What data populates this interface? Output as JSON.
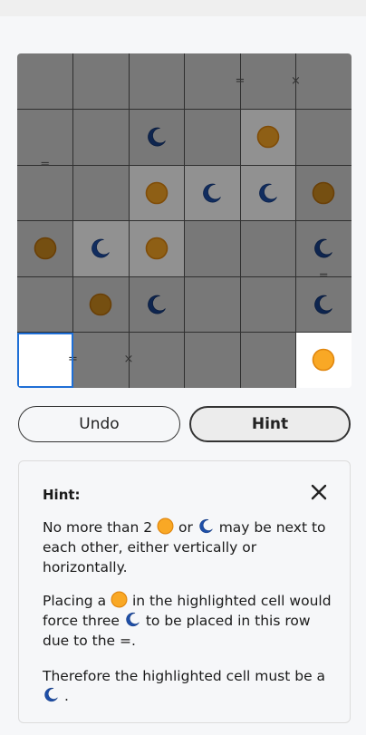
{
  "colors": {
    "sun": "#f9a825",
    "sun_border": "#e0860e",
    "moon": "#1e4fa8",
    "overlay": "#000000",
    "selection": "#1f6fd6"
  },
  "board": {
    "size": 6,
    "cells": [
      [
        "",
        "",
        "",
        "",
        "",
        ""
      ],
      [
        "",
        "",
        "moon",
        "",
        "sun",
        ""
      ],
      [
        "",
        "",
        "sun",
        "moon",
        "moon",
        "sun"
      ],
      [
        "sun",
        "moon",
        "sun",
        "",
        "",
        "moon"
      ],
      [
        "",
        "sun",
        "moon",
        "",
        "",
        "moon"
      ],
      [
        "",
        "",
        "",
        "",
        "",
        "sun"
      ]
    ],
    "lighter_cells": [
      [
        1,
        4
      ],
      [
        2,
        2
      ],
      [
        2,
        3
      ],
      [
        2,
        4
      ],
      [
        3,
        1
      ],
      [
        3,
        2
      ]
    ],
    "clear_cells": [
      [
        5,
        0
      ],
      [
        5,
        5
      ]
    ],
    "selected_cell": [
      5,
      0
    ],
    "constraints": [
      {
        "cell": [
          0,
          3
        ],
        "dir": "right",
        "symbol": "="
      },
      {
        "cell": [
          0,
          4
        ],
        "dir": "right",
        "symbol": "×"
      },
      {
        "cell": [
          1,
          0
        ],
        "dir": "down",
        "symbol": "="
      },
      {
        "cell": [
          3,
          5
        ],
        "dir": "down",
        "symbol": "="
      },
      {
        "cell": [
          5,
          0
        ],
        "dir": "right",
        "symbol": "="
      },
      {
        "cell": [
          5,
          1
        ],
        "dir": "right",
        "symbol": "×"
      }
    ]
  },
  "buttons": {
    "undo": "Undo",
    "hint": "Hint"
  },
  "hint": {
    "title": "Hint:",
    "p1": {
      "a": "No more than 2",
      "b": "or",
      "c": "may be next to each other, either vertically or horizontally."
    },
    "p2": {
      "a": "Placing a",
      "b": "in the highlighted cell would force three",
      "c": "to be placed in this row due to the =."
    },
    "p3": {
      "a": "Therefore the highlighted cell must be a",
      "b": "."
    }
  }
}
